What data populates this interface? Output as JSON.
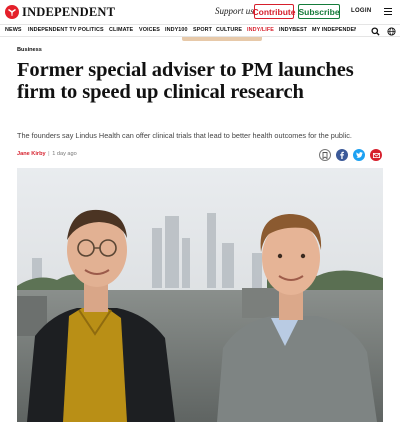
{
  "header": {
    "brand": "INDEPENDENT",
    "support_text": "Support us",
    "contribute_label": "Contribute",
    "subscribe_label": "Subscribe",
    "login_label": "LOGIN",
    "icons": {
      "logo": "eagle-logo-icon",
      "menu": "hamburger-menu-icon",
      "search": "search-icon",
      "edition": "globe-icon"
    }
  },
  "nav": {
    "items": [
      {
        "label": "NEWS"
      },
      {
        "label": "INDEPENDENT TV"
      },
      {
        "label": "POLITICS"
      },
      {
        "label": "CLIMATE"
      },
      {
        "label": "VOICES"
      },
      {
        "label": "INDY100"
      },
      {
        "label": "SPORT"
      },
      {
        "label": "CULTURE"
      },
      {
        "label": "INDY/LIFE"
      },
      {
        "label": "INDYBEST"
      },
      {
        "label": "MY INDEPENDENT"
      }
    ]
  },
  "article": {
    "section": "Business",
    "headline": "Former special adviser to PM launches firm to speed up clinical research",
    "standfirst": "The founders say Lindus Health can offer clinical trials that lead to better health outcomes for the public.",
    "author": "Jane Kirby",
    "time_ago": "1 day ago",
    "share_icons": [
      "bookmark-icon",
      "facebook-icon",
      "twitter-icon",
      "email-icon"
    ]
  },
  "colors": {
    "brand_red": "#d61f2c",
    "subscribe_green": "#157b3a",
    "facebook_blue": "#3b5998",
    "twitter_blue": "#1da1f2"
  }
}
